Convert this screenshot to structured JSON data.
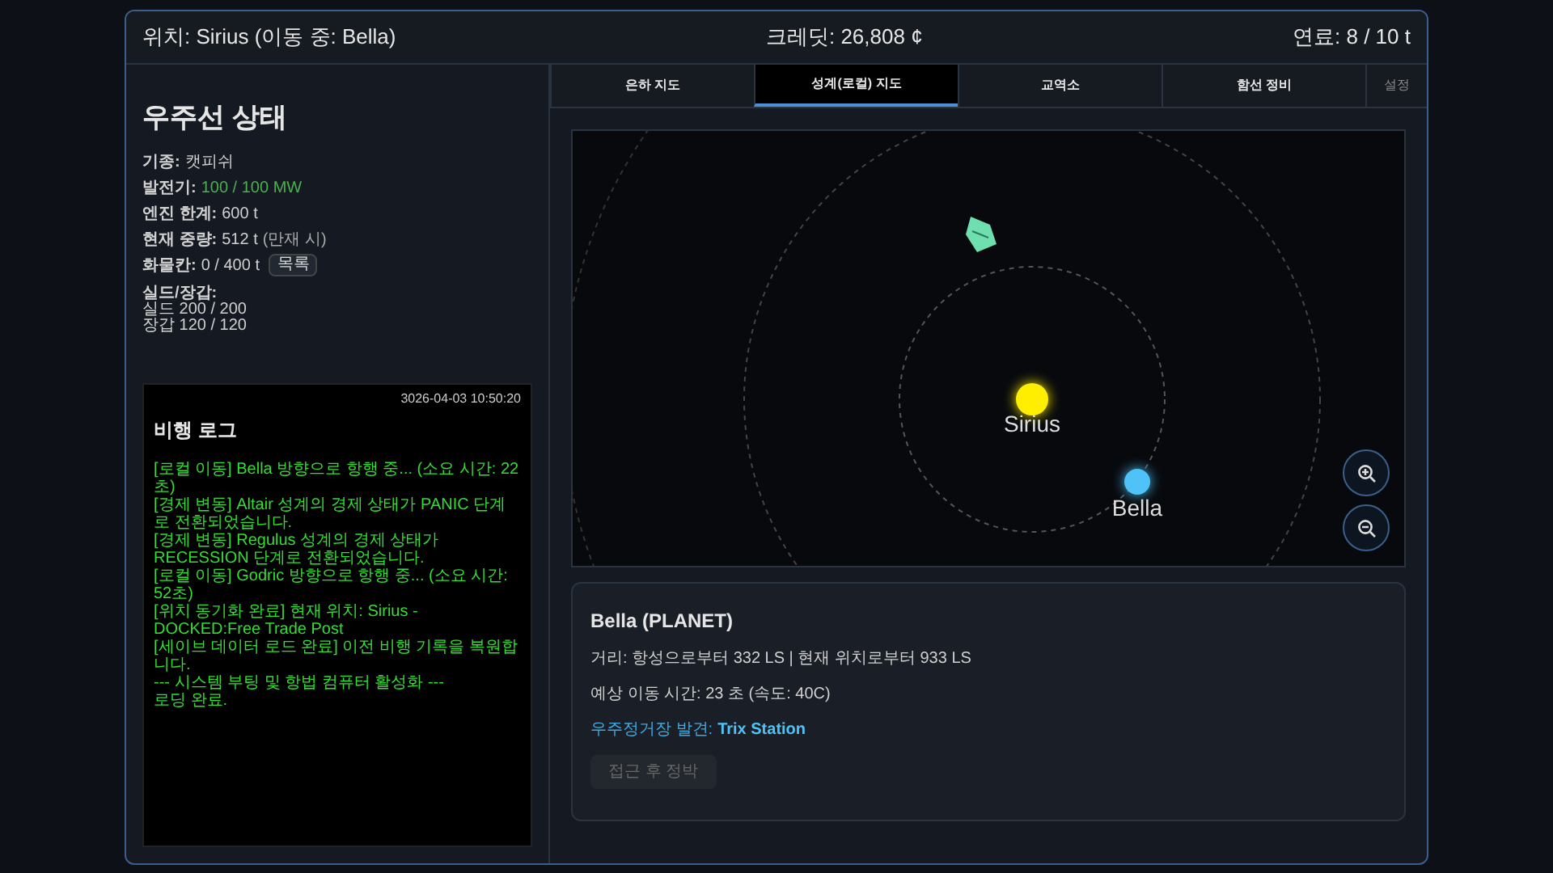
{
  "header": {
    "location": "위치: Sirius (이동 중: Bella)",
    "credits": "크레딧: 26,808 ¢",
    "fuel": "연료: 8 / 10 t"
  },
  "ship_status": {
    "title": "우주선 상태",
    "stats": [
      {
        "label": "기종:",
        "value": "캣피쉬"
      },
      {
        "label": "발전기:",
        "value": "100 / 100 MW",
        "color": "#4caf50"
      },
      {
        "label": "엔진 한계:",
        "value": "600 t"
      },
      {
        "label": "현재 중량:",
        "value": "512 t",
        "note": "(만재 시)"
      },
      {
        "label": "화물칸:",
        "value": "0 / 400 t",
        "button": "목록"
      }
    ],
    "defense": {
      "label": "실드/장갑:",
      "lines": [
        "실드 200 / 200",
        "장갑 120 / 120"
      ]
    }
  },
  "flight_log": {
    "timestamp": "3026-04-03 10:50:20",
    "title": "비행 로그",
    "entries": [
      "[로컬 이동] Bella 방향으로 항행 중... (소요 시간: 22초)",
      "[경제 변동] Altair 성계의 경제 상태가 PANIC 단계로 전환되었습니다.",
      "[경제 변동] Regulus 성계의 경제 상태가 RECESSION 단계로 전환되었습니다.",
      "[로컬 이동] Godric 방향으로 항행 중... (소요 시간: 52초)",
      "[위치 동기화 완료] 현재 위치: Sirius - DOCKED:Free Trade Post",
      "[세이브 데이터 로드 완료] 이전 비행 기록을 복원합니다.",
      "--- 시스템 부팅 및 항법 컴퓨터 활성화 ---",
      "로딩 완료."
    ]
  },
  "tabs": [
    {
      "label": "은하 지도",
      "selected": false,
      "kind": "main"
    },
    {
      "label": "성계(로컬) 지도",
      "selected": true,
      "kind": "main"
    },
    {
      "label": "교역소",
      "selected": false,
      "kind": "main"
    },
    {
      "label": "함선 정비",
      "selected": false,
      "kind": "main"
    },
    {
      "label": "설정",
      "selected": false,
      "kind": "minor"
    }
  ],
  "map": {
    "bodies": [
      {
        "name": "Sirius",
        "kind": "star",
        "color": "#ffee00"
      },
      {
        "name": "Bella",
        "kind": "planet",
        "color": "#4fc3f7"
      }
    ]
  },
  "info": {
    "title": "Bella (PLANET)",
    "distance": "거리: 항성으로부터 332 LS | 현재 위치로부터 933 LS",
    "eta": "예상 이동 시간: 23 초 (속도: 40C)",
    "station_label": "우주정거장 발견:",
    "station_name": "Trix Station",
    "button": {
      "label": "접근 후 정박",
      "disabled": true
    }
  }
}
